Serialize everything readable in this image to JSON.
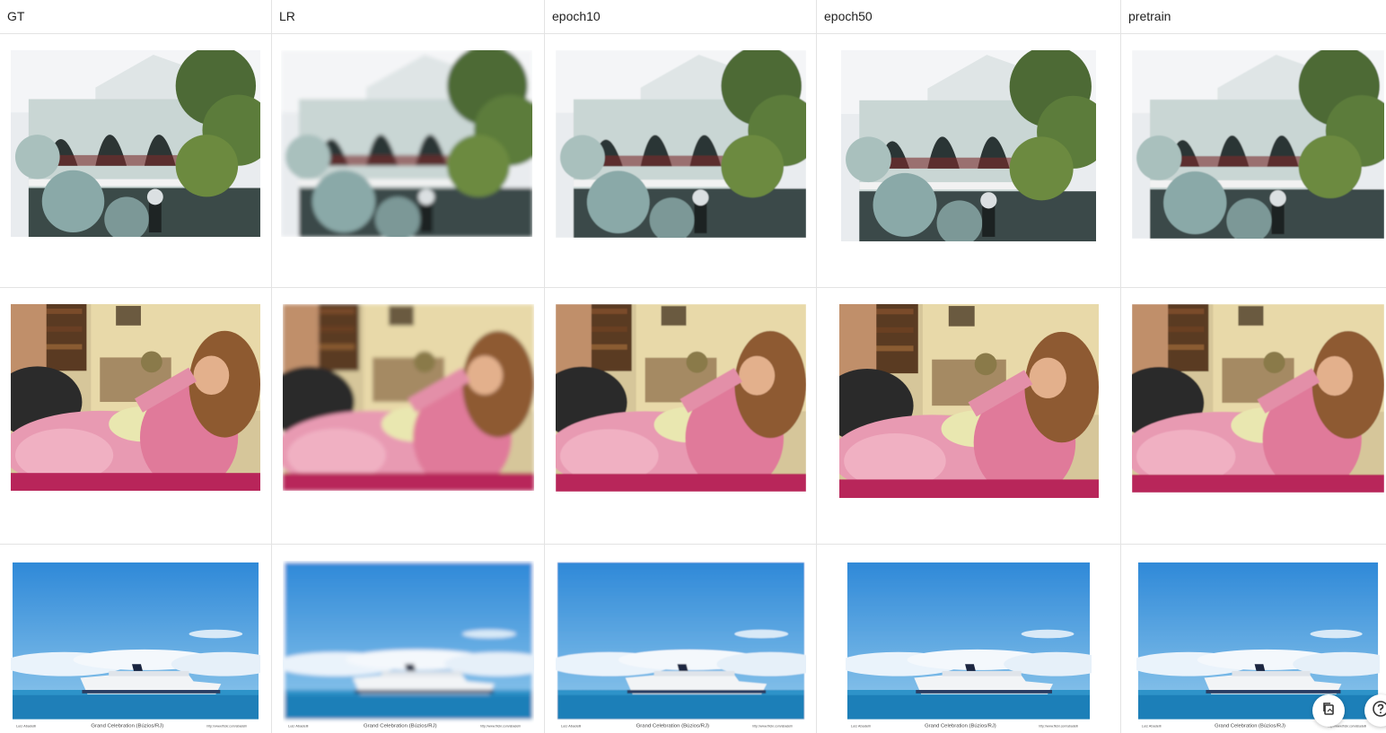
{
  "columns": [
    {
      "header": "GT",
      "blur": 0
    },
    {
      "header": "LR",
      "blur": 2.2
    },
    {
      "header": "epoch10",
      "blur": 0.6
    },
    {
      "header": "epoch50",
      "blur": 0.3
    },
    {
      "header": "pretrain",
      "blur": 0.4
    }
  ],
  "rows": [
    {
      "scene": "house"
    },
    {
      "scene": "child"
    },
    {
      "scene": "ship"
    }
  ],
  "ship_caption": {
    "left": "Luiz Abadelli",
    "center": "Grand Celebration (Búzios/RJ)",
    "right": "http://www.flickr.com/abadelli"
  },
  "fab_icons": [
    "copy-icon",
    "help-icon"
  ]
}
